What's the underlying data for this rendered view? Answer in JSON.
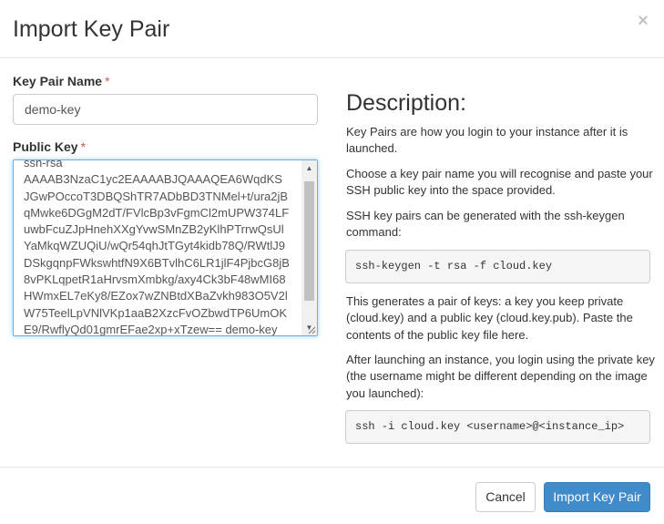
{
  "modal": {
    "title": "Import Key Pair",
    "close_symbol": "×"
  },
  "form": {
    "key_name_label": "Key Pair Name",
    "key_name_required": "*",
    "key_name_value": "demo-key",
    "public_key_label": "Public Key",
    "public_key_required": "*",
    "public_key_value": "ssh-rsa\nAAAAB3NzaC1yc2EAAAABJQAAAQEA6WqdKS\nJGwPOccoT3DBQShTR7ADbBD3TNMel+t/ura2jB\nqMwke6DGgM2dT/FVlcBp3vFgmCl2mUPW374LF\nuwbFcuZJpHnehXXgYvwSMnZB2yKlhPTrrwQsUl\nYaMkqWZUQiU/wQr54qhJtTGyt4kidb78Q/RWtlJ9\nDSkgqnpFWkswhtfN9X6BTvlhC6LR1jlF4PjbcG8jB\n8vPKLqpetR1aHrvsmXmbkg/axy4Ck3bF48wMI68\nHWmxEL7eKy8/EZox7wZNBtdXBaZvkh983O5V2l\nW75TeelLpVNlVKp1aaB2XzcFvOZbwdTP6UmOK\nE9/RwflyQd01gmrEFae2xp+xTzew== demo-key"
  },
  "description": {
    "title": "Description:",
    "p1": "Key Pairs are how you login to your instance after it is launched.",
    "p2": "Choose a key pair name you will recognise and paste your SSH public key into the space provided.",
    "p3": "SSH key pairs can be generated with the ssh-keygen command:",
    "code1": "ssh-keygen -t rsa -f cloud.key",
    "p4": "This generates a pair of keys: a key you keep private (cloud.key) and a public key (cloud.key.pub). Paste the contents of the public key file here.",
    "p5": "After launching an instance, you login using the private key (the username might be different depending on the image you launched):",
    "code2": "ssh -i cloud.key <username>@<instance_ip>"
  },
  "footer": {
    "cancel_label": "Cancel",
    "submit_label": "Import Key Pair"
  },
  "icons": {
    "scroll_up": "▲",
    "scroll_down": "▼"
  },
  "colors": {
    "primary": "#428bca",
    "required": "#d9534f",
    "focus_border": "#66afe9"
  }
}
